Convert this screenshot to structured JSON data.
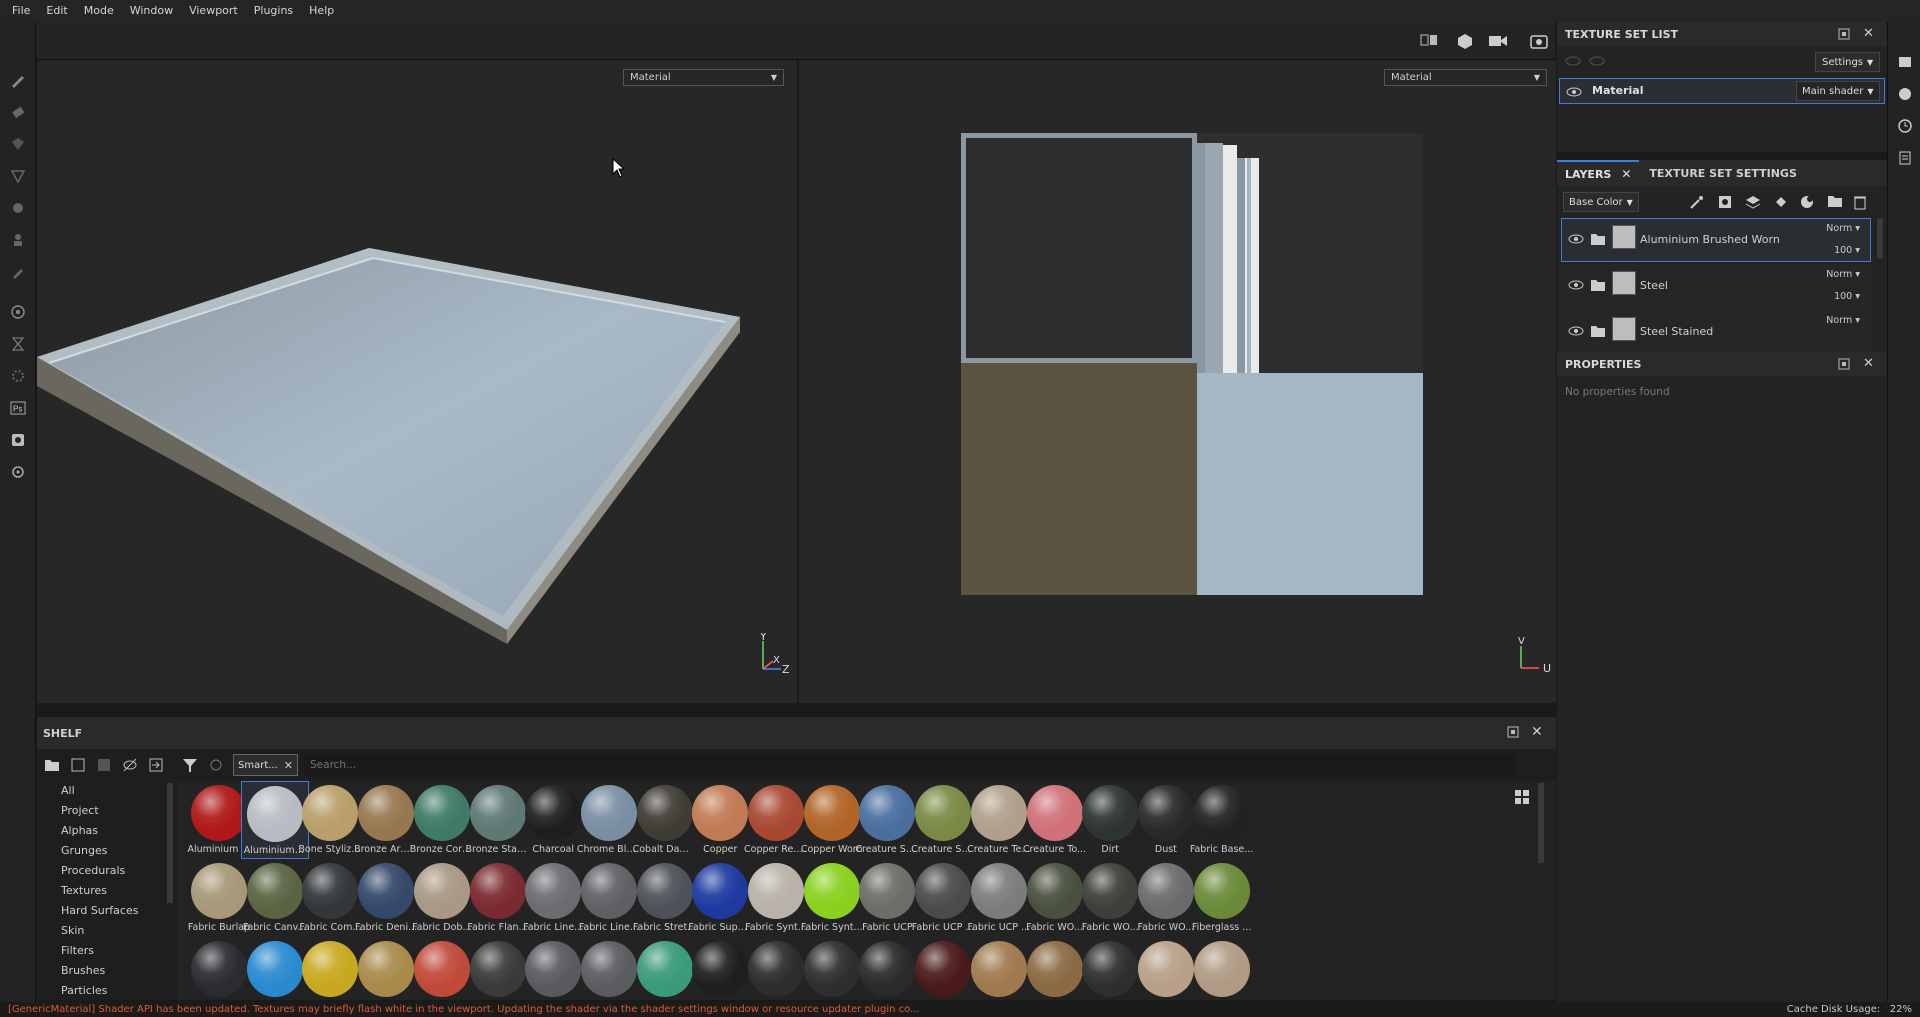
{
  "menu": [
    "File",
    "Edit",
    "Mode",
    "Window",
    "Viewport",
    "Plugins",
    "Help"
  ],
  "viewport3d": {
    "mode": "Material",
    "axes": {
      "y": "Y",
      "x": "X",
      "z": "Z"
    }
  },
  "viewport2d": {
    "mode": "Material",
    "axes": {
      "v": "V",
      "u": "U"
    }
  },
  "texture_set_list": {
    "title": "TEXTURE SET LIST",
    "settings_label": "Settings",
    "item_name": "Material",
    "item_shader": "Main shader"
  },
  "layers_panel": {
    "tab_layers": "LAYERS",
    "tab_texture_set_settings": "TEXTURE SET SETTINGS",
    "channel": "Base Color",
    "layers": [
      {
        "name": "Aluminium Brushed Worn",
        "blend": "Norm",
        "opacity": "100",
        "selected": true
      },
      {
        "name": "Steel",
        "blend": "Norm",
        "opacity": "100",
        "selected": false
      },
      {
        "name": "Steel Stained",
        "blend": "Norm",
        "opacity": "",
        "selected": false
      }
    ]
  },
  "properties": {
    "title": "PROPERTIES",
    "empty": "No properties found"
  },
  "shelf": {
    "title": "SHELF",
    "filter_tag": "Smart...",
    "search_placeholder": "Search...",
    "categories": [
      "All",
      "Project",
      "Alphas",
      "Grunges",
      "Procedurals",
      "Textures",
      "Hard Surfaces",
      "Skin",
      "Filters",
      "Brushes",
      "Particles"
    ],
    "materials": [
      {
        "label": "Aluminium ...",
        "color": "#b01818"
      },
      {
        "label": "Aluminium ...",
        "color": "#b8bcc2"
      },
      {
        "label": "Bone Stylized",
        "color": "#b89e6a"
      },
      {
        "label": "Bronze Arm...",
        "color": "#96784e"
      },
      {
        "label": "Bronze Corr...",
        "color": "#3e7a68"
      },
      {
        "label": "Bronze Stat...",
        "color": "#5e7874"
      },
      {
        "label": "Charcoal",
        "color": "#1e1e1e"
      },
      {
        "label": "Chrome Blu...",
        "color": "#7a8ea2"
      },
      {
        "label": "Cobalt Dam...",
        "color": "#3e3c34"
      },
      {
        "label": "Copper",
        "color": "#c07a54"
      },
      {
        "label": "Copper Red...",
        "color": "#a84832"
      },
      {
        "label": "Copper Worn",
        "color": "#b06428"
      },
      {
        "label": "Creature Ski...",
        "color": "#4a6e9e"
      },
      {
        "label": "Creature Ski...",
        "color": "#7a8a44"
      },
      {
        "label": "Creature Te...",
        "color": "#b0a08a"
      },
      {
        "label": "Creature To...",
        "color": "#d07078"
      },
      {
        "label": "Dirt",
        "color": "#2e3430"
      },
      {
        "label": "Dust",
        "color": "#28292a"
      },
      {
        "label": "Fabric Base...",
        "color": "#222222"
      },
      {
        "label": "Fabric Burlap",
        "color": "#a69878"
      },
      {
        "label": "Fabric Canv...",
        "color": "#5a6442"
      },
      {
        "label": "Fabric Com...",
        "color": "#33363a"
      },
      {
        "label": "Fabric Deni...",
        "color": "#34486a"
      },
      {
        "label": "Fabric Dob...",
        "color": "#a89884"
      },
      {
        "label": "Fabric Flan...",
        "color": "#7a2a30"
      },
      {
        "label": "Fabric Line...",
        "color": "#6a6c70"
      },
      {
        "label": "Fabric Line...",
        "color": "#5e6064"
      },
      {
        "label": "Fabric Stret...",
        "color": "#4e5258"
      },
      {
        "label": "Fabric Supe...",
        "color": "#1e3aa0"
      },
      {
        "label": "Fabric Synt...",
        "color": "#b8b2a8"
      },
      {
        "label": "Fabric Synt...",
        "color": "#8ad01e"
      },
      {
        "label": "Fabric UCP",
        "color": "#6a6e66"
      },
      {
        "label": "Fabric UCP ...",
        "color": "#4a4c4c"
      },
      {
        "label": "Fabric UCP ...",
        "color": "#7a7c7e"
      },
      {
        "label": "Fabric WO...",
        "color": "#4a5040"
      },
      {
        "label": "Fabric WO...",
        "color": "#3c4038"
      },
      {
        "label": "Fabric WO...",
        "color": "#6a6c6c"
      },
      {
        "label": "Fiberglass ...",
        "color": "#6a8a3a"
      },
      {
        "label": "",
        "color": "#2a2c30"
      },
      {
        "label": "",
        "color": "#2a8ad0"
      },
      {
        "label": "",
        "color": "#c8a820"
      },
      {
        "label": "",
        "color": "#a88a4a"
      },
      {
        "label": "",
        "color": "#c04a3a"
      },
      {
        "label": "",
        "color": "#3a3a3a"
      },
      {
        "label": "",
        "color": "#585a5e"
      },
      {
        "label": "",
        "color": "#5a5c60"
      },
      {
        "label": "",
        "color": "#3a9a7a"
      },
      {
        "label": "",
        "color": "#1e1e1e"
      },
      {
        "label": "",
        "color": "#2e2c2a"
      },
      {
        "label": "",
        "color": "#2c2e30"
      },
      {
        "label": "",
        "color": "#282a2c"
      },
      {
        "label": "",
        "color": "#4a1a1a"
      },
      {
        "label": "",
        "color": "#a07a4e"
      },
      {
        "label": "",
        "color": "#8a6a44"
      },
      {
        "label": "",
        "color": "#2c2e30"
      },
      {
        "label": "",
        "color": "#b8a088"
      },
      {
        "label": "",
        "color": "#b09a84"
      }
    ]
  },
  "status": {
    "message": "[GenericMaterial] Shader API has been updated. Textures may briefly flash white in the viewport. Updating the shader via the shader settings window or resource updater plugin co...",
    "cache_label": "Cache Disk Usage:",
    "cache_value": "22%"
  }
}
